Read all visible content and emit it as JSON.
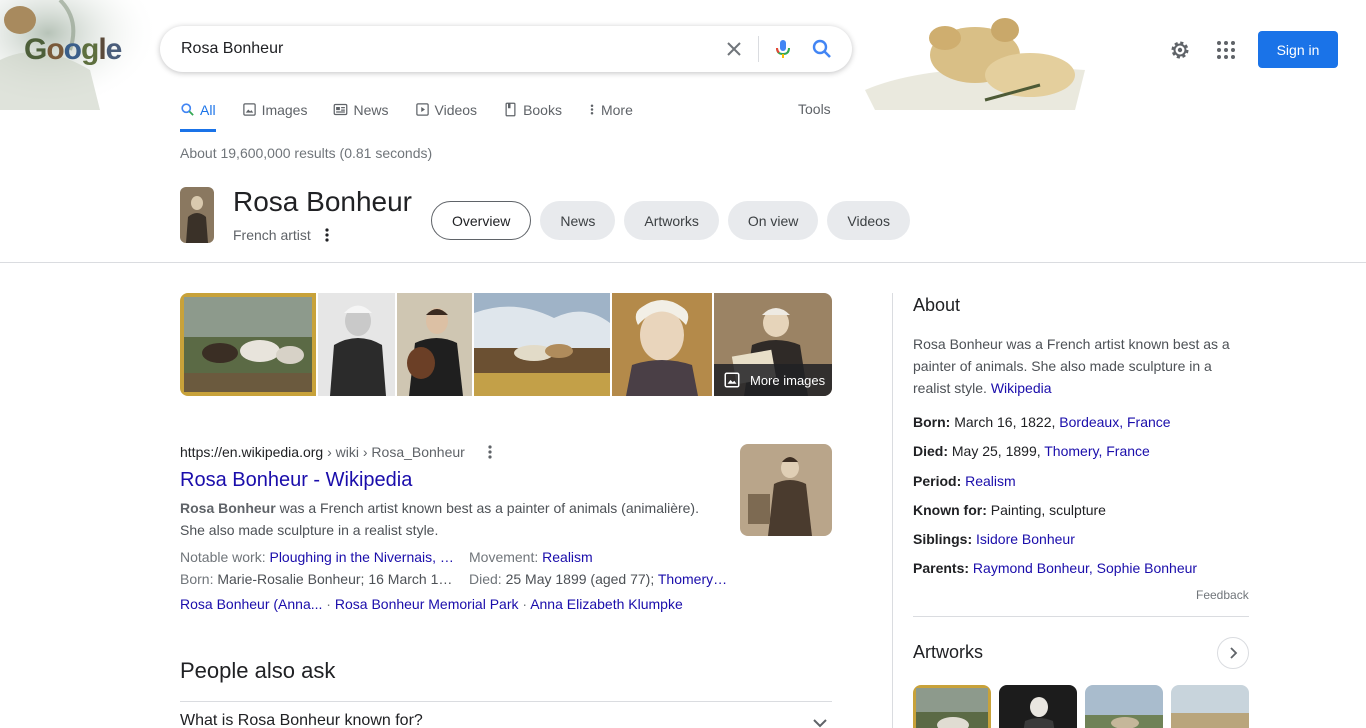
{
  "logo": {
    "letters": [
      "G",
      "o",
      "o",
      "g",
      "l",
      "e"
    ]
  },
  "search": {
    "query": "Rosa Bonheur"
  },
  "header": {
    "signin_label": "Sign in"
  },
  "tabs": [
    {
      "label": "All",
      "icon": "search-icon"
    },
    {
      "label": "Images",
      "icon": "image-icon"
    },
    {
      "label": "News",
      "icon": "news-icon"
    },
    {
      "label": "Videos",
      "icon": "video-icon"
    },
    {
      "label": "Books",
      "icon": "book-icon"
    },
    {
      "label": "More",
      "icon": "more-vert-icon"
    }
  ],
  "tools_label": "Tools",
  "result_stats": "About 19,600,000 results (0.81 seconds)",
  "entity": {
    "title": "Rosa Bonheur",
    "subtitle": "French artist",
    "chips": [
      "Overview",
      "News",
      "Artworks",
      "On view",
      "Videos"
    ]
  },
  "images": {
    "more_label": "More images"
  },
  "result": {
    "url_host": "https://en.wikipedia.org",
    "url_path": " › wiki › Rosa_Bonheur",
    "title": "Rosa Bonheur - Wikipedia",
    "snippet_bold": "Rosa Bonheur",
    "snippet_rest": " was a French artist known best as a painter of animals (animalière). She also made sculpture in a realist style.",
    "facts": {
      "notable_label": "Notable work: ",
      "notable_value": "Ploughing in the Nivernais, …",
      "movement_label": "Movement: ",
      "movement_value": "Realism",
      "born_label": "Born: ",
      "born_value": "Marie-Rosalie Bonheur; 16 March 1…",
      "died_label": "Died: ",
      "died_value": "25 May 1899 (aged 77); ",
      "died_link": "Thomery…"
    },
    "sitelinks": [
      "Rosa Bonheur (Anna...",
      "Rosa Bonheur Memorial Park",
      "Anna Elizabeth Klumpke"
    ]
  },
  "paa": {
    "title": "People also ask",
    "question": "What is Rosa Bonheur known for?"
  },
  "kp": {
    "about_title": "About",
    "description": "Rosa Bonheur was a French artist known best as a painter of animals. She also made sculpture in a realist style. ",
    "desc_link": "Wikipedia",
    "facts": [
      {
        "label": "Born:",
        "text": " March 16, 1822, ",
        "link": "Bordeaux, France"
      },
      {
        "label": "Died:",
        "text": " May 25, 1899, ",
        "link": "Thomery, France"
      },
      {
        "label": "Period:",
        "text": " ",
        "link": "Realism"
      },
      {
        "label": "Known for:",
        "text": " Painting, sculpture",
        "link": ""
      },
      {
        "label": "Siblings:",
        "text": " ",
        "link": "Isidore Bonheur"
      },
      {
        "label": "Parents:",
        "text": " ",
        "link": "Raymond Bonheur, Sophie Bonheur"
      }
    ],
    "feedback": "Feedback",
    "artworks_title": "Artworks"
  },
  "colors": {
    "accent": "#1a73e8",
    "link": "#1a0dab"
  }
}
